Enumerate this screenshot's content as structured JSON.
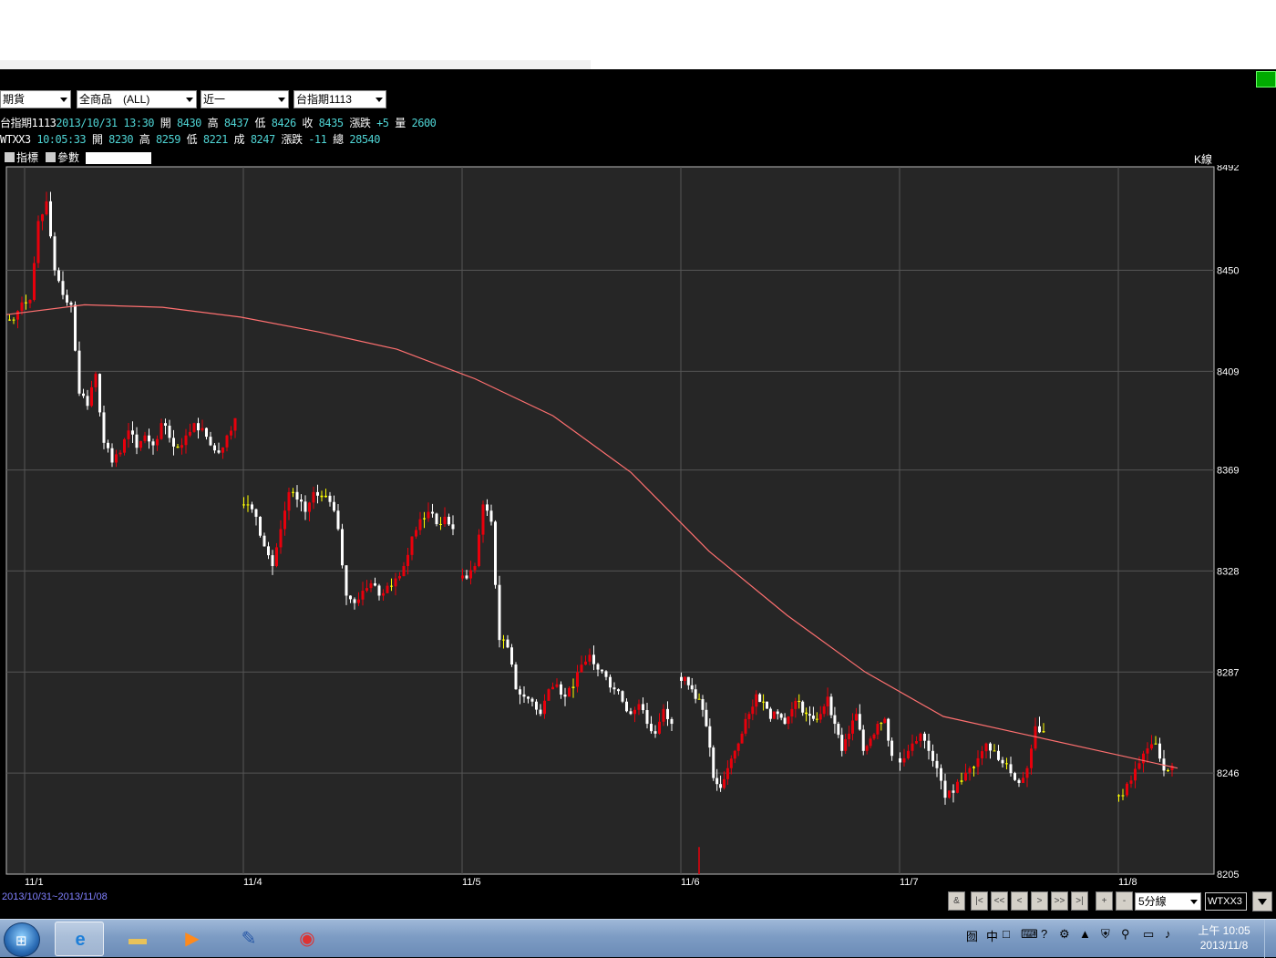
{
  "toolbar": {
    "market_select": "期貨",
    "product_select": "全商品　(ALL)",
    "month_select": "近一",
    "contract_select": "台指期1113"
  },
  "quote_rows": [
    {
      "name": "台指期1113",
      "date": "2013/10/31",
      "time": "13:30",
      "open_label": "開",
      "open": "8430",
      "high_label": "高",
      "high": "8437",
      "low_label": "低",
      "low": "8426",
      "close_label": "收",
      "close": "8435",
      "change_label": "漲跌",
      "change": "+5",
      "vol_label": "量",
      "vol": "2600"
    },
    {
      "name": "WTXX3",
      "date": "",
      "time": "10:05:33",
      "open_label": "開",
      "open": "8230",
      "high_label": "高",
      "high": "8259",
      "low_label": "低",
      "low": "8221",
      "close_label": "成",
      "close": "8247",
      "change_label": "漲跌",
      "change": "-11",
      "vol_label": "總",
      "vol": "28540"
    }
  ],
  "chart_tabs": {
    "indicator_label": "指標",
    "param_label": "參數",
    "kline_label": "K線"
  },
  "date_range": "2013/10/31~2013/11/08",
  "nav_buttons": [
    "&",
    "|<",
    "<<",
    "<",
    ">",
    ">>",
    ">|",
    "+",
    "-"
  ],
  "period_select": "5分線",
  "symbol_input": "WTXX3",
  "taskbar": {
    "clock_time": "上午 10:05",
    "clock_date": "2013/11/8",
    "ime_label": "中",
    "apps": [
      "ie-icon",
      "explorer-icon",
      "media-player-icon",
      "paint-icon",
      "chrome-icon"
    ]
  },
  "colors": {
    "up": "#e8000c",
    "down": "#ffffff",
    "doji": "#ffff00",
    "ma_line": "#ff7070",
    "grid": "#555555",
    "bg": "#262626"
  },
  "chart_data": {
    "type": "candlestick",
    "title": "",
    "ylim": [
      8205,
      8492
    ],
    "y_ticks": [
      8205,
      8246,
      8287,
      8328,
      8369,
      8409,
      8450,
      8492
    ],
    "x_ticks": [
      "11/1",
      "11/4",
      "11/5",
      "11/6",
      "11/7",
      "11/8"
    ],
    "grid": true,
    "ma_series": {
      "name": "",
      "values": [
        8432,
        8436,
        8435,
        8431,
        8425,
        8418,
        8406,
        8391,
        8368,
        8336,
        8310,
        8287,
        8269,
        8262,
        8255,
        8248
      ]
    },
    "segments": [
      {
        "day": "11/1",
        "points": [
          8430,
          8437,
          8438,
          8470,
          8478,
          8450,
          8440,
          8436,
          8400,
          8395,
          8408,
          8380,
          8372,
          8376,
          8385,
          8378,
          8383,
          8379,
          8388,
          8382,
          8378,
          8383,
          8388,
          8386,
          8379,
          8376,
          8383,
          8390
        ]
      },
      {
        "day": "11/4",
        "points": [
          8355,
          8350,
          8338,
          8330,
          8345,
          8360,
          8357,
          8352,
          8360,
          8358,
          8356,
          8345,
          8318,
          8315,
          8320,
          8323,
          8318,
          8322,
          8325,
          8330,
          8342,
          8349,
          8352,
          8347,
          8350,
          8345
        ]
      },
      {
        "day": "11/5",
        "points": [
          8325,
          8330,
          8355,
          8348,
          8300,
          8297,
          8280,
          8277,
          8275,
          8270,
          8280,
          8282,
          8277,
          8281,
          8290,
          8294,
          8288,
          8285,
          8280,
          8275,
          8270,
          8274,
          8266,
          8262,
          8272,
          8266
        ]
      },
      {
        "day": "11/6",
        "points": [
          8285,
          8280,
          8276,
          8265,
          8244,
          8240,
          8248,
          8255,
          8262,
          8270,
          8278,
          8275,
          8268,
          8270,
          8266,
          8272,
          8275,
          8270,
          8268,
          8270,
          8277,
          8266,
          8255,
          8262,
          8270,
          8255,
          8260,
          8266,
          8268,
          8253
        ]
      },
      {
        "day": "11/7",
        "points": [
          8252,
          8258,
          8262,
          8255,
          8248,
          8236,
          8238,
          8243,
          8248,
          8252,
          8258,
          8255,
          8250,
          8246,
          8242,
          8248,
          8265,
          8263
        ]
      },
      {
        "day": "11/8",
        "points": [
          8237,
          8243,
          8250,
          8256,
          8258,
          8247,
          8249
        ]
      }
    ]
  }
}
